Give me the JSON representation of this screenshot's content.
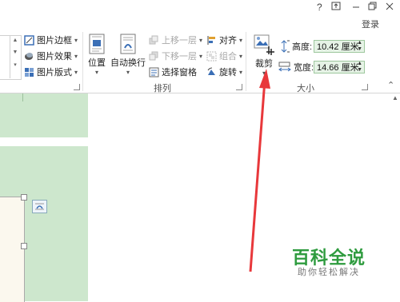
{
  "window": {
    "help": "?",
    "login": "登录"
  },
  "ribbon": {
    "picture_styles": {
      "border": "图片边框",
      "effects": "图片效果",
      "layout": "图片版式"
    },
    "arrange": {
      "position": "位置",
      "wrap_text": "自动换行",
      "bring_forward": "上移一层",
      "send_backward": "下移一层",
      "selection_pane": "选择窗格",
      "align": "对齐",
      "group": "组合",
      "rotate": "旋转",
      "group_label": "排列"
    },
    "size": {
      "crop": "裁剪",
      "height_label": "高度:",
      "height_value": "10.42 厘米",
      "width_label": "宽度:",
      "width_value": "14.66 厘米",
      "group_label": "大小"
    }
  },
  "watermark": {
    "title": "百科全说",
    "subtitle": "助你轻松解决"
  },
  "colors": {
    "page_green": "#cde7cd",
    "arrow_red": "#e8383b",
    "watermark_green": "#2e9b3e"
  }
}
